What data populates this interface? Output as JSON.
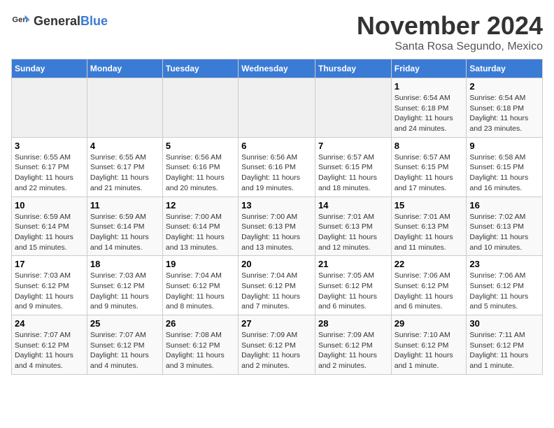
{
  "header": {
    "logo_general": "General",
    "logo_blue": "Blue",
    "month": "November 2024",
    "location": "Santa Rosa Segundo, Mexico"
  },
  "days_of_week": [
    "Sunday",
    "Monday",
    "Tuesday",
    "Wednesday",
    "Thursday",
    "Friday",
    "Saturday"
  ],
  "weeks": [
    [
      {
        "day": "",
        "info": ""
      },
      {
        "day": "",
        "info": ""
      },
      {
        "day": "",
        "info": ""
      },
      {
        "day": "",
        "info": ""
      },
      {
        "day": "",
        "info": ""
      },
      {
        "day": "1",
        "info": "Sunrise: 6:54 AM\nSunset: 6:18 PM\nDaylight: 11 hours and 24 minutes."
      },
      {
        "day": "2",
        "info": "Sunrise: 6:54 AM\nSunset: 6:18 PM\nDaylight: 11 hours and 23 minutes."
      }
    ],
    [
      {
        "day": "3",
        "info": "Sunrise: 6:55 AM\nSunset: 6:17 PM\nDaylight: 11 hours and 22 minutes."
      },
      {
        "day": "4",
        "info": "Sunrise: 6:55 AM\nSunset: 6:17 PM\nDaylight: 11 hours and 21 minutes."
      },
      {
        "day": "5",
        "info": "Sunrise: 6:56 AM\nSunset: 6:16 PM\nDaylight: 11 hours and 20 minutes."
      },
      {
        "day": "6",
        "info": "Sunrise: 6:56 AM\nSunset: 6:16 PM\nDaylight: 11 hours and 19 minutes."
      },
      {
        "day": "7",
        "info": "Sunrise: 6:57 AM\nSunset: 6:15 PM\nDaylight: 11 hours and 18 minutes."
      },
      {
        "day": "8",
        "info": "Sunrise: 6:57 AM\nSunset: 6:15 PM\nDaylight: 11 hours and 17 minutes."
      },
      {
        "day": "9",
        "info": "Sunrise: 6:58 AM\nSunset: 6:15 PM\nDaylight: 11 hours and 16 minutes."
      }
    ],
    [
      {
        "day": "10",
        "info": "Sunrise: 6:59 AM\nSunset: 6:14 PM\nDaylight: 11 hours and 15 minutes."
      },
      {
        "day": "11",
        "info": "Sunrise: 6:59 AM\nSunset: 6:14 PM\nDaylight: 11 hours and 14 minutes."
      },
      {
        "day": "12",
        "info": "Sunrise: 7:00 AM\nSunset: 6:14 PM\nDaylight: 11 hours and 13 minutes."
      },
      {
        "day": "13",
        "info": "Sunrise: 7:00 AM\nSunset: 6:13 PM\nDaylight: 11 hours and 13 minutes."
      },
      {
        "day": "14",
        "info": "Sunrise: 7:01 AM\nSunset: 6:13 PM\nDaylight: 11 hours and 12 minutes."
      },
      {
        "day": "15",
        "info": "Sunrise: 7:01 AM\nSunset: 6:13 PM\nDaylight: 11 hours and 11 minutes."
      },
      {
        "day": "16",
        "info": "Sunrise: 7:02 AM\nSunset: 6:13 PM\nDaylight: 11 hours and 10 minutes."
      }
    ],
    [
      {
        "day": "17",
        "info": "Sunrise: 7:03 AM\nSunset: 6:12 PM\nDaylight: 11 hours and 9 minutes."
      },
      {
        "day": "18",
        "info": "Sunrise: 7:03 AM\nSunset: 6:12 PM\nDaylight: 11 hours and 9 minutes."
      },
      {
        "day": "19",
        "info": "Sunrise: 7:04 AM\nSunset: 6:12 PM\nDaylight: 11 hours and 8 minutes."
      },
      {
        "day": "20",
        "info": "Sunrise: 7:04 AM\nSunset: 6:12 PM\nDaylight: 11 hours and 7 minutes."
      },
      {
        "day": "21",
        "info": "Sunrise: 7:05 AM\nSunset: 6:12 PM\nDaylight: 11 hours and 6 minutes."
      },
      {
        "day": "22",
        "info": "Sunrise: 7:06 AM\nSunset: 6:12 PM\nDaylight: 11 hours and 6 minutes."
      },
      {
        "day": "23",
        "info": "Sunrise: 7:06 AM\nSunset: 6:12 PM\nDaylight: 11 hours and 5 minutes."
      }
    ],
    [
      {
        "day": "24",
        "info": "Sunrise: 7:07 AM\nSunset: 6:12 PM\nDaylight: 11 hours and 4 minutes."
      },
      {
        "day": "25",
        "info": "Sunrise: 7:07 AM\nSunset: 6:12 PM\nDaylight: 11 hours and 4 minutes."
      },
      {
        "day": "26",
        "info": "Sunrise: 7:08 AM\nSunset: 6:12 PM\nDaylight: 11 hours and 3 minutes."
      },
      {
        "day": "27",
        "info": "Sunrise: 7:09 AM\nSunset: 6:12 PM\nDaylight: 11 hours and 2 minutes."
      },
      {
        "day": "28",
        "info": "Sunrise: 7:09 AM\nSunset: 6:12 PM\nDaylight: 11 hours and 2 minutes."
      },
      {
        "day": "29",
        "info": "Sunrise: 7:10 AM\nSunset: 6:12 PM\nDaylight: 11 hours and 1 minute."
      },
      {
        "day": "30",
        "info": "Sunrise: 7:11 AM\nSunset: 6:12 PM\nDaylight: 11 hours and 1 minute."
      }
    ]
  ]
}
